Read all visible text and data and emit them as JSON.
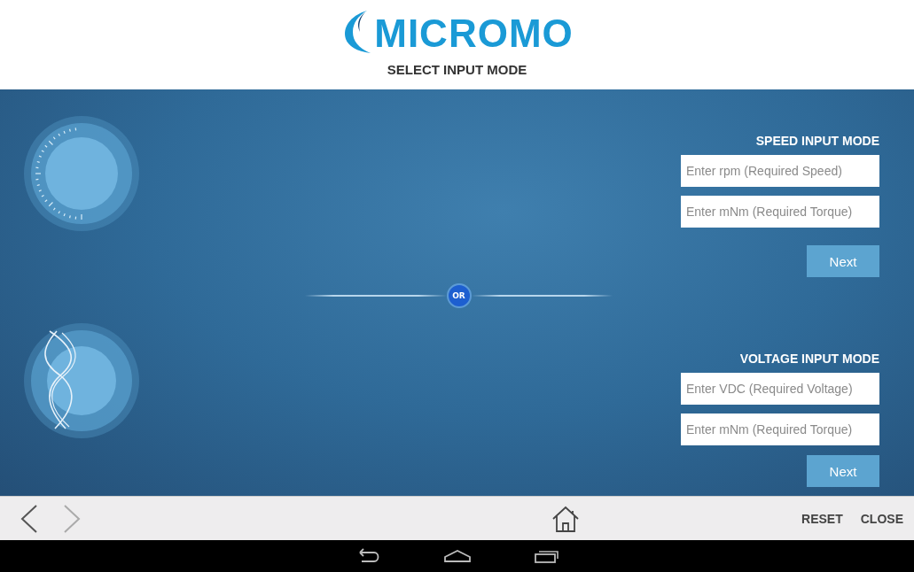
{
  "header": {
    "logo": "MICROMO",
    "title": "SELECT INPUT MODE"
  },
  "modes": [
    {
      "kind": "speed",
      "title": "SPEED INPUT MODE",
      "fields": [
        {
          "placeholder": "Enter rpm (Required Speed)"
        },
        {
          "placeholder": "Enter mNm (Required Torque)"
        }
      ],
      "button": "Next"
    },
    {
      "kind": "voltage",
      "title": "VOLTAGE INPUT MODE",
      "fields": [
        {
          "placeholder": "Enter VDC (Required Voltage)"
        },
        {
          "placeholder": "Enter mNm (Required Torque)"
        }
      ],
      "button": "Next"
    }
  ],
  "divider": {
    "label": "OR"
  },
  "bottom_bar": {
    "back": {
      "disabled": false
    },
    "forward": {
      "disabled": true
    },
    "actions": [
      "RESET",
      "CLOSE"
    ]
  }
}
